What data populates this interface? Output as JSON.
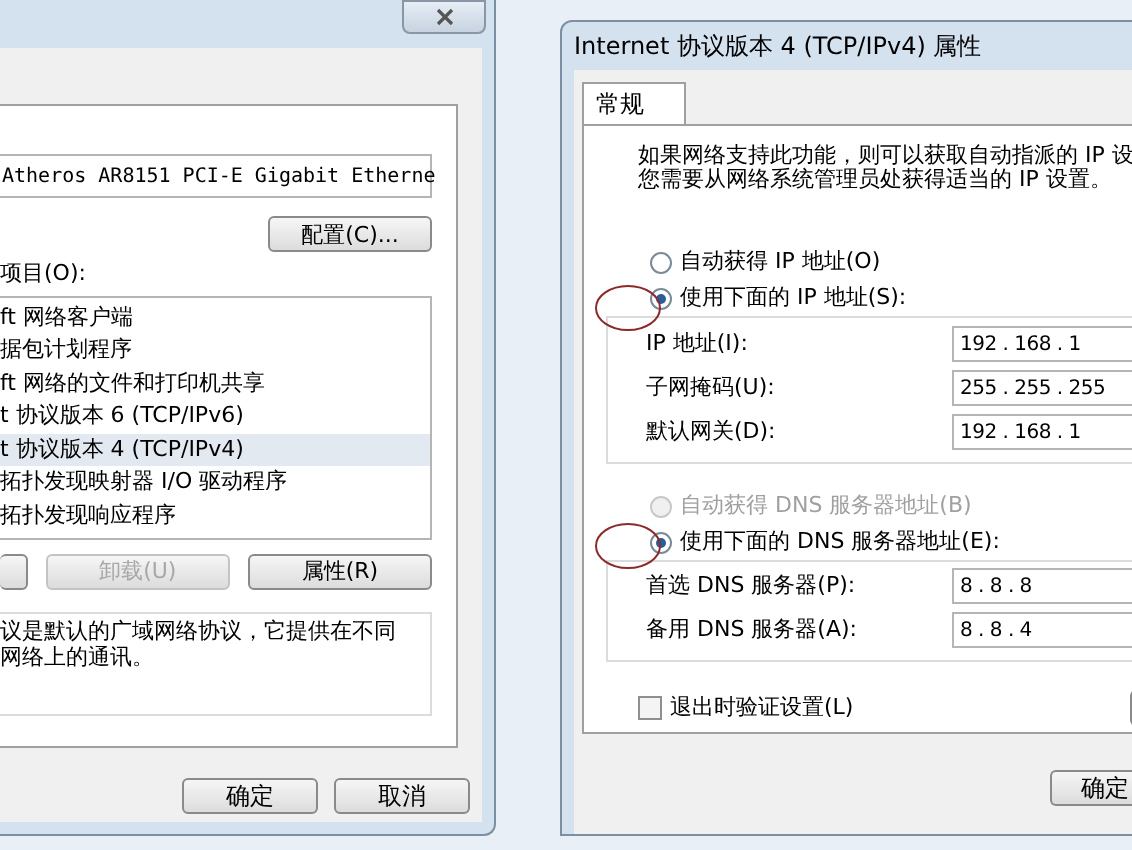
{
  "left_dialog": {
    "adapter": "Atheros AR8151 PCI-E Gigabit Etherne",
    "configure_button": "配置(C)...",
    "items_label": "项目(O):",
    "items": [
      {
        "label": "ft 网络客户端",
        "selected": false
      },
      {
        "label": "据包计划程序",
        "selected": false
      },
      {
        "label": "ft 网络的文件和打印机共享",
        "selected": false
      },
      {
        "label": "t 协议版本 6 (TCP/IPv6)",
        "selected": false
      },
      {
        "label": "t 协议版本 4 (TCP/IPv4)",
        "selected": true
      },
      {
        "label": "拓扑发现映射器 I/O 驱动程序",
        "selected": false
      },
      {
        "label": "拓扑发现响应程序",
        "selected": false
      }
    ],
    "buttons": [
      {
        "label": "卸载(U)",
        "disabled": true
      },
      {
        "label": "属性(R)",
        "disabled": false
      }
    ],
    "description": [
      "议是默认的广域网络协议，它提供在不同",
      "网络上的通讯。"
    ],
    "footer_buttons": [
      "确定",
      "取消"
    ]
  },
  "right_dialog": {
    "title": "Internet 协议版本 4 (TCP/IPv4) 属性",
    "tabs": [
      {
        "label": "常规",
        "selected": true
      }
    ],
    "intro": [
      "如果网络支持此功能，则可以获取自动指派的 IP 设",
      "您需要从网络系统管理员处获得适当的 IP 设置。"
    ],
    "ip_mode": [
      {
        "label": "自动获得 IP 地址(O)",
        "selected": false,
        "disabled": false
      },
      {
        "label": "使用下面的 IP 地址(S):",
        "selected": true,
        "disabled": false
      }
    ],
    "ip_fields": [
      {
        "label": "IP 地址(I):",
        "value": "192 . 168 . 1"
      },
      {
        "label": "子网掩码(U):",
        "value": "255 . 255 . 255"
      },
      {
        "label": "默认网关(D):",
        "value": "192 . 168 . 1"
      }
    ],
    "dns_mode": [
      {
        "label": "自动获得 DNS 服务器地址(B)",
        "selected": false,
        "disabled": true
      },
      {
        "label": "使用下面的 DNS 服务器地址(E):",
        "selected": true,
        "disabled": false
      }
    ],
    "dns_fields": [
      {
        "label": "首选 DNS 服务器(P):",
        "value": "8 . 8 . 8"
      },
      {
        "label": "备用 DNS 服务器(A):",
        "value": "8 . 8 . 4"
      }
    ],
    "validate_checkbox": {
      "label": "退出时验证设置(L)",
      "checked": false
    },
    "footer_buttons": [
      "确定"
    ]
  }
}
